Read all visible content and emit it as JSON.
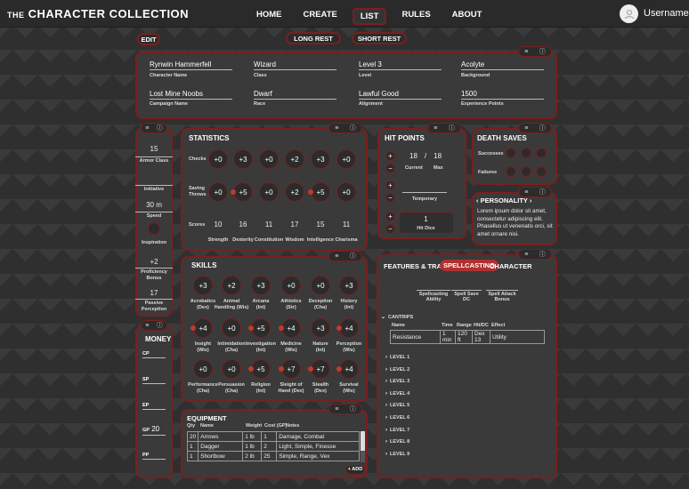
{
  "nav": {
    "brand_small": "THE",
    "brand": "CHARACTER COLLECTION",
    "links": [
      "HOME",
      "CREATE",
      "LIST",
      "RULES",
      "ABOUT"
    ],
    "username": "Username"
  },
  "actions": {
    "edit": "EDIT",
    "long_rest": "LONG REST",
    "short_rest": "SHORT REST"
  },
  "tools": {
    "menu": "≡",
    "info": "ⓘ"
  },
  "info": {
    "name": "Rynwin Hammerfell",
    "name_label": "Character Name",
    "class": "Wizard",
    "class_label": "Class",
    "level": "Level 3",
    "level_label": "Level",
    "background": "Acolyte",
    "background_label": "Background",
    "campaign": "Lost Mine Noobs",
    "campaign_label": "Campaign Name",
    "race": "Dwarf",
    "race_label": "Race",
    "alignment": "Lawful Good",
    "alignment_label": "Alignment",
    "xp": "1500",
    "xp_label": "Experience Points"
  },
  "combat": {
    "ac": "15",
    "ac_label": "Armor Class",
    "init_label": "Initiative",
    "speed": "30 m",
    "speed_label": "Speed",
    "inspiration_label": "Inspiration",
    "prof": "+2",
    "prof_label1": "Proficiency",
    "prof_label2": "Bonus",
    "passive": "17",
    "passive_label1": "Passive",
    "passive_label2": "Perception"
  },
  "stats": {
    "title": "STATISTICS",
    "checks_label": "Checks",
    "saving_label1": "Saving",
    "saving_label2": "Throws",
    "scores_label": "Scores",
    "checks": [
      "+0",
      "+3",
      "+0",
      "+2",
      "+3",
      "+0"
    ],
    "saves": [
      "+0",
      "+5",
      "+0",
      "+2",
      "+5",
      "+0"
    ],
    "scores": [
      "10",
      "16",
      "11",
      "17",
      "15",
      "11"
    ],
    "names": [
      "Strength",
      "Dexterity",
      "Constitution",
      "Wisdom",
      "Intelligence",
      "Charisma"
    ]
  },
  "hp": {
    "title": "HIT POINTS",
    "current": "18",
    "slash": "/",
    "max": "18",
    "current_label": "Current",
    "max_label": "Max",
    "temp_label": "Temporary",
    "dice": "1",
    "dice_label": "Hit Dice"
  },
  "death": {
    "title": "DEATH SAVES",
    "successes": "Successes",
    "failures": "Failures"
  },
  "personality": {
    "title": "PERSONALITY",
    "text": "Lorem ipsum dolor sit amet, consectetur adipiscing elit. Phasellus ut  venenatis orci, sit amet ornare nisi."
  },
  "skills": {
    "title": "SKILLS",
    "items": [
      {
        "v": "+3",
        "n1": "Acrobatics",
        "n2": "(Dex)"
      },
      {
        "v": "+2",
        "n1": "Animal",
        "n2": "Handling (Wis)"
      },
      {
        "v": "+3",
        "n1": "Arcana",
        "n2": "(Int)"
      },
      {
        "v": "+0",
        "n1": "Athletics",
        "n2": "(Str)"
      },
      {
        "v": "+0",
        "n1": "Deception",
        "n2": "(Cha)"
      },
      {
        "v": "+3",
        "n1": "History",
        "n2": "(Int)"
      },
      {
        "v": "+4",
        "n1": "Insight",
        "n2": "(Wis)"
      },
      {
        "v": "+0",
        "n1": "Intimidation",
        "n2": "(Cha)"
      },
      {
        "v": "+5",
        "n1": "Investigation",
        "n2": "(Int)"
      },
      {
        "v": "+4",
        "n1": "Medicine",
        "n2": "(Wis)"
      },
      {
        "v": "+3",
        "n1": "Nature",
        "n2": "(Int)"
      },
      {
        "v": "+4",
        "n1": "Perception",
        "n2": "(Wis)"
      },
      {
        "v": "+0",
        "n1": "Performance",
        "n2": "(Cha)"
      },
      {
        "v": "+0",
        "n1": "Persuasion",
        "n2": "(Cha)"
      },
      {
        "v": "+5",
        "n1": "Religion",
        "n2": "(Int)"
      },
      {
        "v": "+7",
        "n1": "Sleight of",
        "n2": "Hand (Dex)"
      },
      {
        "v": "+7",
        "n1": "Stealth",
        "n2": "(Dex)"
      },
      {
        "v": "+4",
        "n1": "Survival",
        "n2": "(Wis)"
      }
    ]
  },
  "money": {
    "title": "MONEY",
    "cp": "CP",
    "sp": "SP",
    "ep": "EP",
    "gp": "GP",
    "gp_value": "20",
    "pp": "PP"
  },
  "equipment": {
    "title": "EQUIPMENT",
    "headers": [
      "Qty",
      "Name",
      "Weight",
      "Cost (GP)",
      "Notes"
    ],
    "rows": [
      [
        "20",
        "Arrows",
        "1 lb",
        "1",
        "Damage, Combat"
      ],
      [
        "1",
        "Dagger",
        "1 lb",
        "2",
        "Light, Simple, Finesse"
      ],
      [
        "1",
        "Shortbow",
        "2 lb",
        "25",
        "Simple, Range, Vex"
      ]
    ],
    "add": "+ ADD"
  },
  "features": {
    "tabs": [
      "FEATURES & TRAITS",
      "SPELLCASTING",
      "CHARACTER"
    ],
    "ability_label1": "Spellcasting",
    "ability_label2": "Ability",
    "dc_label1": "Spell Save",
    "dc_label2": "DC",
    "bonus_label1": "Spell Attack",
    "bonus_label2": "Bonus",
    "cantrips": "CANTRIPS",
    "cantrip_headers": [
      "Name",
      "Time",
      "Range",
      "Hit/DC",
      "Effect"
    ],
    "cantrip_row": [
      "Resistance",
      "1 min",
      "120 ft",
      "Dex 13",
      "Utility"
    ],
    "levels": [
      "LEVEL 1",
      "LEVEL 2",
      "LEVEL 3",
      "LEVEL 4",
      "LEVEL 5",
      "LEVEL 6",
      "LEVEL 7",
      "LEVEL 8",
      "LEVEL 9"
    ]
  },
  "colors": {
    "accent": "#7a1f1f",
    "dot": "#c0392b",
    "panel": "#3a3a3a"
  }
}
